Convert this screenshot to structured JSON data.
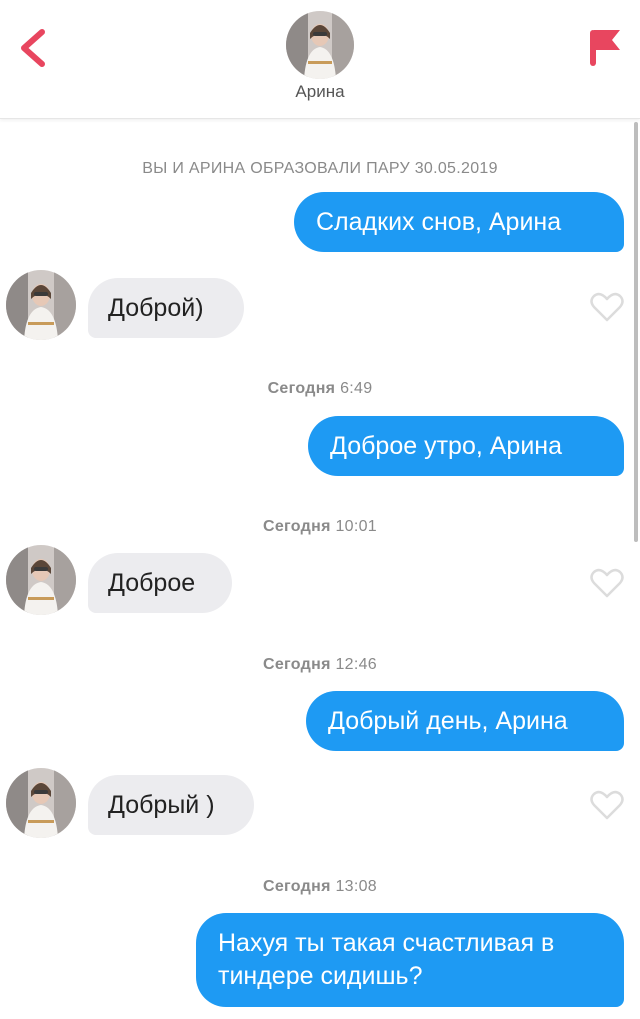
{
  "header": {
    "contact_name": "Арина",
    "back_icon": "chevron-left-icon",
    "report_icon": "flag-icon",
    "accent_color": "#e8465f"
  },
  "chat": {
    "match_notice": "ВЫ И АРИНА ОБРАЗОВАЛИ ПАРУ 30.05.2019",
    "messages": [
      {
        "direction": "out",
        "text": "Сладких снов, Арина"
      },
      {
        "direction": "in",
        "text": "Доброй)"
      },
      {
        "direction": "separator",
        "day": "Сегодня",
        "time": "6:49"
      },
      {
        "direction": "out",
        "text": "Доброе утро, Арина"
      },
      {
        "direction": "separator",
        "day": "Сегодня",
        "time": "10:01"
      },
      {
        "direction": "in",
        "text": "Доброе"
      },
      {
        "direction": "separator",
        "day": "Сегодня",
        "time": "12:46"
      },
      {
        "direction": "out",
        "text": "Добрый день, Арина"
      },
      {
        "direction": "in",
        "text": "Добрый )"
      },
      {
        "direction": "separator",
        "day": "Сегодня",
        "time": "13:08"
      },
      {
        "direction": "out",
        "text": "Нахуя ты такая счастливая в тиндере сидишь?"
      }
    ],
    "like_icon": "heart-outline-icon",
    "outgoing_color": "#1e9af3",
    "incoming_color": "#ececef"
  }
}
